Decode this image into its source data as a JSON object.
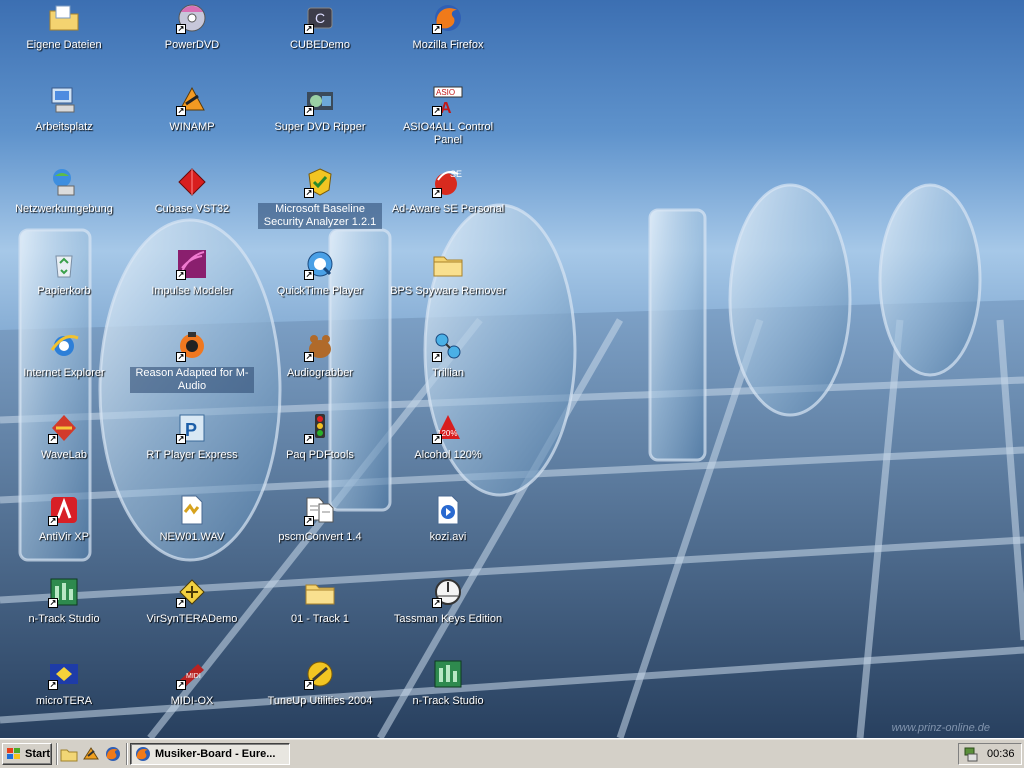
{
  "desktop": {
    "icons": [
      {
        "label": "Eigene Dateien",
        "icon": "folder-documents-icon",
        "shortcut": false
      },
      {
        "label": "Arbeitsplatz",
        "icon": "my-computer-icon",
        "shortcut": false
      },
      {
        "label": "Netzwerkumgebung",
        "icon": "network-places-icon",
        "shortcut": false
      },
      {
        "label": "Papierkorb",
        "icon": "recycle-bin-icon",
        "shortcut": false
      },
      {
        "label": "Internet Explorer",
        "icon": "internet-explorer-icon",
        "shortcut": false
      },
      {
        "label": "WaveLab",
        "icon": "wavelab-icon",
        "shortcut": true
      },
      {
        "label": "AntiVir XP",
        "icon": "antivir-icon",
        "shortcut": true
      },
      {
        "label": "n-Track Studio",
        "icon": "ntrack-icon",
        "shortcut": true
      },
      {
        "label": "microTERA",
        "icon": "microtera-icon",
        "shortcut": true
      },
      {
        "label": "PowerDVD",
        "icon": "powerdvd-icon",
        "shortcut": true
      },
      {
        "label": "WINAMP",
        "icon": "winamp-icon",
        "shortcut": true
      },
      {
        "label": "Cubase VST32",
        "icon": "cubase-icon",
        "shortcut": false
      },
      {
        "label": "Impulse Modeler",
        "icon": "impulse-modeler-icon",
        "shortcut": true
      },
      {
        "label": "Reason Adapted for M-Audio",
        "icon": "reason-icon",
        "shortcut": true
      },
      {
        "label": "RT Player Express",
        "icon": "rt-player-icon",
        "shortcut": true
      },
      {
        "label": "NEW01.WAV",
        "icon": "wav-file-icon",
        "shortcut": false
      },
      {
        "label": "VirSynTERADemo",
        "icon": "virsyn-icon",
        "shortcut": true
      },
      {
        "label": "MIDI-OX",
        "icon": "midiox-icon",
        "shortcut": true
      },
      {
        "label": "CUBEDemo",
        "icon": "cubedemo-icon",
        "shortcut": true
      },
      {
        "label": "Super DVD Ripper",
        "icon": "dvd-ripper-icon",
        "shortcut": true
      },
      {
        "label": "Microsoft Baseline Security Analyzer 1.2.1",
        "icon": "mbsa-icon",
        "shortcut": true
      },
      {
        "label": "QuickTime Player",
        "icon": "quicktime-icon",
        "shortcut": true
      },
      {
        "label": "Audiograbber",
        "icon": "audiograbber-icon",
        "shortcut": true
      },
      {
        "label": "Paq PDFtools",
        "icon": "pdftools-icon",
        "shortcut": true
      },
      {
        "label": "pscmConvert 1.4",
        "icon": "pscmconvert-icon",
        "shortcut": true
      },
      {
        "label": "01 - Track  1",
        "icon": "folder-icon",
        "shortcut": false
      },
      {
        "label": "TuneUp Utilities 2004",
        "icon": "tuneup-icon",
        "shortcut": true
      },
      {
        "label": "Mozilla Firefox",
        "icon": "firefox-icon",
        "shortcut": true
      },
      {
        "label": "ASIO4ALL Control Panel",
        "icon": "asio4all-icon",
        "shortcut": true
      },
      {
        "label": "Ad-Aware SE Personal",
        "icon": "adaware-icon",
        "shortcut": true
      },
      {
        "label": "BPS Spyware Remover",
        "icon": "folder-icon",
        "shortcut": false
      },
      {
        "label": "Trillian",
        "icon": "trillian-icon",
        "shortcut": true
      },
      {
        "label": "Alcohol 120%",
        "icon": "alcohol-icon",
        "shortcut": true
      },
      {
        "label": "kozi.avi",
        "icon": "avi-file-icon",
        "shortcut": false
      },
      {
        "label": "Tassman Keys Edition",
        "icon": "tassman-icon",
        "shortcut": true
      },
      {
        "label": "n-Track Studio",
        "icon": "ntrack-icon",
        "shortcut": false
      }
    ],
    "watermark": "www.prinz-online.de"
  },
  "taskbar": {
    "start_label": "Start",
    "quicklaunch": [
      "show-desktop-icon",
      "winamp-quicklaunch-icon",
      "firefox-quicklaunch-icon"
    ],
    "task_label": "Musiker-Board - Eure...",
    "clock": "00:36"
  },
  "colors": {
    "taskbar": "#d4d0c8",
    "desktop_sky": "#5f93cc"
  }
}
